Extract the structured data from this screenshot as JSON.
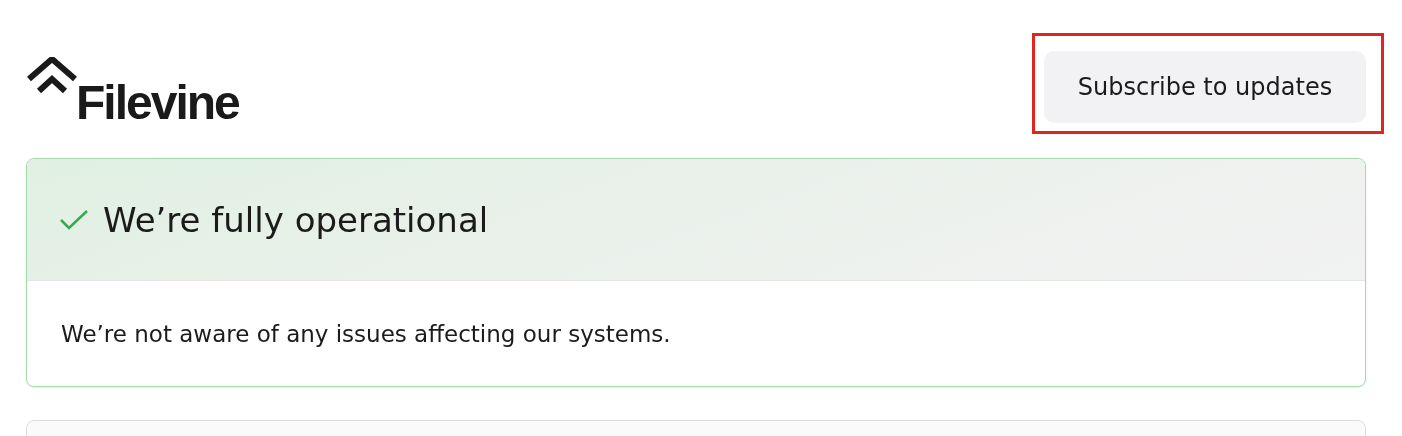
{
  "header": {
    "logo_text": "Filevine",
    "subscribe_button": {
      "label": "Subscribe to updates",
      "highlighted": true
    }
  },
  "status": {
    "kind": "operational",
    "title": "We’re fully operational",
    "message": "We’re not aware of any issues affecting our systems."
  }
}
